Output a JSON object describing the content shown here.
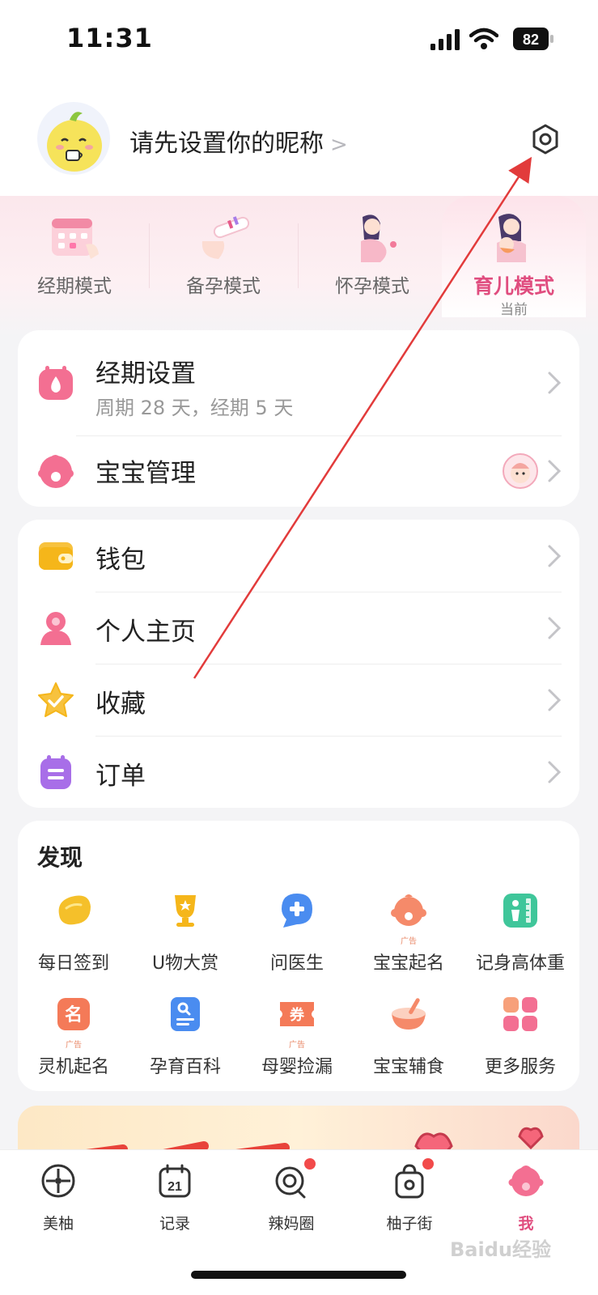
{
  "status": {
    "time": "11:31",
    "battery": "82"
  },
  "profile": {
    "nickname_prompt": "请先设置你的昵称",
    "chevron": ">"
  },
  "modes": [
    {
      "label": "经期模式"
    },
    {
      "label": "备孕模式"
    },
    {
      "label": "怀孕模式"
    },
    {
      "label": "育儿模式",
      "sub": "当前"
    }
  ],
  "settings_card": {
    "period": {
      "title": "经期设置",
      "subtitle": "周期 28 天，经期 5 天"
    },
    "baby": {
      "title": "宝宝管理"
    }
  },
  "menu": [
    {
      "label": "钱包"
    },
    {
      "label": "个人主页"
    },
    {
      "label": "收藏"
    },
    {
      "label": "订单"
    }
  ],
  "discover": {
    "title": "发现",
    "ad_tag": "广告",
    "items": [
      {
        "label": "每日签到"
      },
      {
        "label": "U物大赏"
      },
      {
        "label": "问医生"
      },
      {
        "label": "宝宝起名"
      },
      {
        "label": "记身高体重"
      },
      {
        "label": "灵机起名"
      },
      {
        "label": "孕育百科"
      },
      {
        "label": "母婴捡漏"
      },
      {
        "label": "宝宝辅食"
      },
      {
        "label": "更多服务"
      }
    ]
  },
  "tabs": [
    {
      "label": "美柚"
    },
    {
      "label": "记录"
    },
    {
      "label": "辣妈圈"
    },
    {
      "label": "柚子街"
    },
    {
      "label": "我"
    }
  ],
  "watermark": "Baidu经验",
  "colors": {
    "accent": "#e04d7f",
    "annotation": "#e23b3b",
    "background": "#f4f4f6"
  }
}
